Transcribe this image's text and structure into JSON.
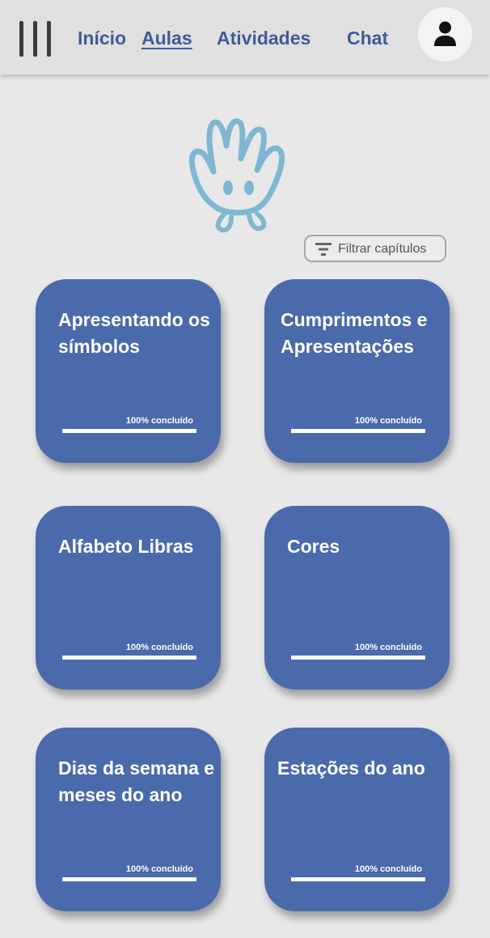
{
  "nav": {
    "items": [
      {
        "label": "Início",
        "active": false
      },
      {
        "label": "Aulas",
        "active": true
      },
      {
        "label": "Atividades",
        "active": false
      },
      {
        "label": "Chat",
        "active": false
      }
    ],
    "menu_icon": "hamburger-menu-icon",
    "profile_icon": "user-icon"
  },
  "mascot": {
    "icon": "hand-mascot-icon"
  },
  "filter": {
    "label": "Filtrar capítulos",
    "icon": "filter-icon"
  },
  "chapters": [
    {
      "title": "Apresentando os símbolos",
      "progress_label": "100% concluído",
      "progress": 1.0
    },
    {
      "title": "Cumprimentos e Apresentações",
      "progress_label": "100% concluído",
      "progress": 1.0
    },
    {
      "title": "Alfabeto Libras",
      "progress_label": "100% concluído",
      "progress": 1.0
    },
    {
      "title": "Cores",
      "progress_label": "100% concluído",
      "progress": 1.0
    },
    {
      "title": "Dias da semana e meses do ano",
      "progress_label": "100% concluído",
      "progress": 1.0
    },
    {
      "title": "Estações do ano",
      "progress_label": "100% concluído",
      "progress": 1.0
    }
  ],
  "colors": {
    "accent": "#3f5c98",
    "card": "#4a6aab",
    "mascot": "#7fb7d3"
  }
}
